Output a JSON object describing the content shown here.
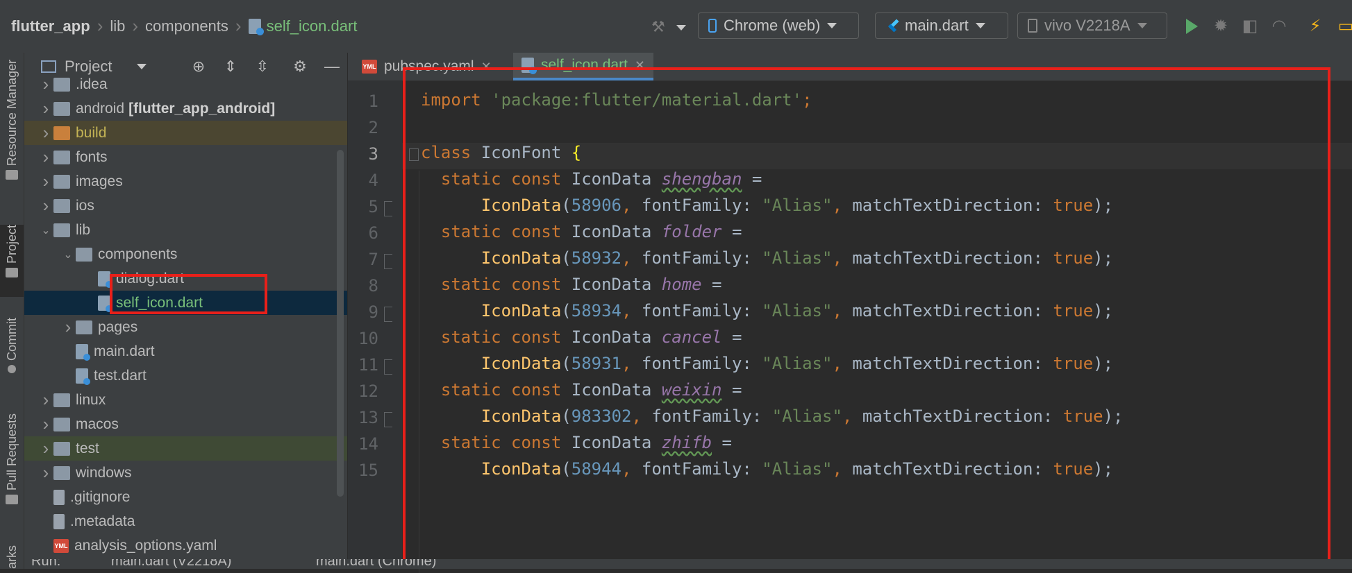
{
  "breadcrumb": {
    "project": "flutter_app",
    "items": [
      "lib",
      "components"
    ],
    "file": "self_icon.dart"
  },
  "toolbar": {
    "device_target": "Chrome (web)",
    "run_config": "main.dart",
    "device": "vivo V2218A"
  },
  "left_strip": {
    "items": [
      "Resource Manager",
      "Project",
      "Commit",
      "Pull Requests",
      "arks"
    ]
  },
  "project_panel": {
    "title": "Project",
    "tree": [
      {
        "name": ".idea",
        "indent": 1,
        "type": "folder",
        "expanded": false,
        "state": "normal"
      },
      {
        "name": "android",
        "suffix": "[flutter_app_android]",
        "indent": 1,
        "type": "folder",
        "expanded": false,
        "state": "normal"
      },
      {
        "name": "build",
        "indent": 1,
        "type": "folder",
        "expanded": false,
        "state": "build"
      },
      {
        "name": "fonts",
        "indent": 1,
        "type": "folder",
        "expanded": false,
        "state": "normal"
      },
      {
        "name": "images",
        "indent": 1,
        "type": "folder",
        "expanded": false,
        "state": "normal"
      },
      {
        "name": "ios",
        "indent": 1,
        "type": "folder",
        "expanded": false,
        "state": "normal"
      },
      {
        "name": "lib",
        "indent": 1,
        "type": "folder",
        "expanded": true,
        "state": "normal"
      },
      {
        "name": "components",
        "indent": 2,
        "type": "folder",
        "expanded": true,
        "state": "normal"
      },
      {
        "name": "dialog.dart",
        "indent": 3,
        "type": "dart",
        "state": "normal"
      },
      {
        "name": "self_icon.dart",
        "indent": 3,
        "type": "dart",
        "state": "selected"
      },
      {
        "name": "pages",
        "indent": 2,
        "type": "folder",
        "expanded": false,
        "state": "normal"
      },
      {
        "name": "main.dart",
        "indent": 2,
        "type": "dart",
        "state": "normal"
      },
      {
        "name": "test.dart",
        "indent": 2,
        "type": "dart",
        "state": "normal"
      },
      {
        "name": "linux",
        "indent": 1,
        "type": "folder",
        "expanded": false,
        "state": "normal"
      },
      {
        "name": "macos",
        "indent": 1,
        "type": "folder",
        "expanded": false,
        "state": "normal"
      },
      {
        "name": "test",
        "indent": 1,
        "type": "folder",
        "expanded": false,
        "state": "test"
      },
      {
        "name": "windows",
        "indent": 1,
        "type": "folder",
        "expanded": false,
        "state": "normal"
      },
      {
        "name": ".gitignore",
        "indent": 1,
        "type": "doc",
        "state": "normal"
      },
      {
        "name": ".metadata",
        "indent": 1,
        "type": "doc",
        "state": "normal"
      },
      {
        "name": "analysis_options.yaml",
        "indent": 1,
        "type": "yml",
        "state": "normal"
      }
    ]
  },
  "editor": {
    "tabs": [
      {
        "label": "pubspec.yaml",
        "icon": "yml-file-icon",
        "active": false
      },
      {
        "label": "self_icon.dart",
        "icon": "dart-file-icon",
        "active": true
      }
    ],
    "line_numbers": [
      "1",
      "2",
      "3",
      "4",
      "5",
      "6",
      "7",
      "8",
      "9",
      "10",
      "11",
      "12",
      "13",
      "14",
      "15"
    ],
    "current_line": "3",
    "code": [
      {
        "n": "1",
        "t": [
          [
            "import ",
            "kw"
          ],
          [
            "'package:flutter/material.dart'",
            "str"
          ],
          [
            ";",
            "kw"
          ]
        ]
      },
      {
        "n": "2",
        "t": []
      },
      {
        "n": "3",
        "t": [
          [
            "class ",
            "kw"
          ],
          [
            "IconFont ",
            ""
          ],
          [
            "{",
            "brace"
          ]
        ]
      },
      {
        "n": "4",
        "t": [
          [
            "  static const ",
            "kw"
          ],
          [
            "IconData ",
            ""
          ],
          [
            "shengban",
            "ital wavy"
          ],
          [
            " =",
            ""
          ]
        ]
      },
      {
        "n": "5",
        "t": [
          [
            "      ",
            ""
          ],
          [
            "IconData",
            "fn"
          ],
          [
            "(",
            ""
          ],
          [
            "58906",
            "num"
          ],
          [
            ", ",
            "kw"
          ],
          [
            "fontFamily: ",
            ""
          ],
          [
            "\"Alias\"",
            "str"
          ],
          [
            ", ",
            "kw"
          ],
          [
            "matchTextDirection: ",
            ""
          ],
          [
            "true",
            "kw"
          ],
          [
            ");",
            ""
          ]
        ]
      },
      {
        "n": "6",
        "t": [
          [
            "  static const ",
            "kw"
          ],
          [
            "IconData ",
            ""
          ],
          [
            "folder",
            "ital"
          ],
          [
            " =",
            ""
          ]
        ]
      },
      {
        "n": "7",
        "t": [
          [
            "      ",
            ""
          ],
          [
            "IconData",
            "fn"
          ],
          [
            "(",
            ""
          ],
          [
            "58932",
            "num"
          ],
          [
            ", ",
            "kw"
          ],
          [
            "fontFamily: ",
            ""
          ],
          [
            "\"Alias\"",
            "str"
          ],
          [
            ", ",
            "kw"
          ],
          [
            "matchTextDirection: ",
            ""
          ],
          [
            "true",
            "kw"
          ],
          [
            ");",
            ""
          ]
        ]
      },
      {
        "n": "8",
        "t": [
          [
            "  static const ",
            "kw"
          ],
          [
            "IconData ",
            ""
          ],
          [
            "home",
            "ital"
          ],
          [
            " =",
            ""
          ]
        ]
      },
      {
        "n": "9",
        "t": [
          [
            "      ",
            ""
          ],
          [
            "IconData",
            "fn"
          ],
          [
            "(",
            ""
          ],
          [
            "58934",
            "num"
          ],
          [
            ", ",
            "kw"
          ],
          [
            "fontFamily: ",
            ""
          ],
          [
            "\"Alias\"",
            "str"
          ],
          [
            ", ",
            "kw"
          ],
          [
            "matchTextDirection: ",
            ""
          ],
          [
            "true",
            "kw"
          ],
          [
            ");",
            ""
          ]
        ]
      },
      {
        "n": "10",
        "t": [
          [
            "  static const ",
            "kw"
          ],
          [
            "IconData ",
            ""
          ],
          [
            "cancel",
            "ital"
          ],
          [
            " =",
            ""
          ]
        ]
      },
      {
        "n": "11",
        "t": [
          [
            "      ",
            ""
          ],
          [
            "IconData",
            "fn"
          ],
          [
            "(",
            ""
          ],
          [
            "58931",
            "num"
          ],
          [
            ", ",
            "kw"
          ],
          [
            "fontFamily: ",
            ""
          ],
          [
            "\"Alias\"",
            "str"
          ],
          [
            ", ",
            "kw"
          ],
          [
            "matchTextDirection: ",
            ""
          ],
          [
            "true",
            "kw"
          ],
          [
            ");",
            ""
          ]
        ]
      },
      {
        "n": "12",
        "t": [
          [
            "  static const ",
            "kw"
          ],
          [
            "IconData ",
            ""
          ],
          [
            "weixin",
            "ital wavy"
          ],
          [
            " =",
            ""
          ]
        ]
      },
      {
        "n": "13",
        "t": [
          [
            "      ",
            ""
          ],
          [
            "IconData",
            "fn"
          ],
          [
            "(",
            ""
          ],
          [
            "983302",
            "num"
          ],
          [
            ", ",
            "kw"
          ],
          [
            "fontFamily: ",
            ""
          ],
          [
            "\"Alias\"",
            "str"
          ],
          [
            ", ",
            "kw"
          ],
          [
            "matchTextDirection: ",
            ""
          ],
          [
            "true",
            "kw"
          ],
          [
            ");",
            ""
          ]
        ]
      },
      {
        "n": "14",
        "t": [
          [
            "  static const ",
            "kw"
          ],
          [
            "IconData ",
            ""
          ],
          [
            "zhifb",
            "ital wavy"
          ],
          [
            " =",
            ""
          ]
        ]
      },
      {
        "n": "15",
        "t": [
          [
            "      ",
            ""
          ],
          [
            "IconData",
            "fn"
          ],
          [
            "(",
            ""
          ],
          [
            "58944",
            "num"
          ],
          [
            ", ",
            "kw"
          ],
          [
            "fontFamily: ",
            ""
          ],
          [
            "\"Alias\"",
            "str"
          ],
          [
            ", ",
            "kw"
          ],
          [
            "matchTextDirection: ",
            ""
          ],
          [
            "true",
            "kw"
          ],
          [
            ");",
            ""
          ]
        ]
      }
    ]
  },
  "run_bar": {
    "label": "Run:",
    "tabs": [
      "main.dart (V2218A)",
      "main.dart (Chrome)"
    ]
  }
}
